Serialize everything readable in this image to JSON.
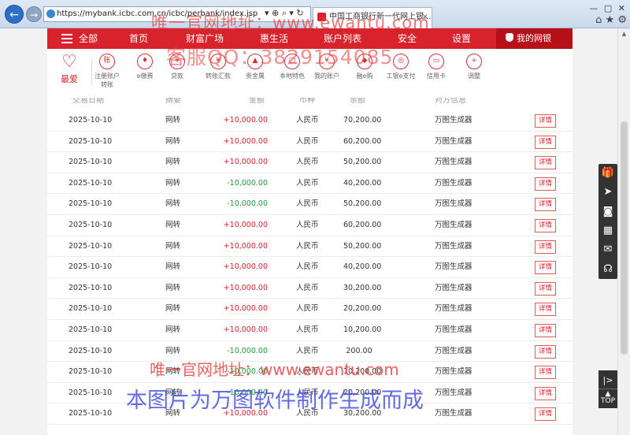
{
  "browser": {
    "url": "https://mybank.icbc.com.cn/icbc/perbank/index.jsp",
    "tab_title": "中国工商银行新一代网上银...",
    "tab_close": "×",
    "window_controls": "— ▢ ✕",
    "home_icons": "⌂ ★ ⚙",
    "addr_tools": "▾ ⊕ ⌕ ▾ ↻"
  },
  "topnav": {
    "menu_label": "全部",
    "items": [
      "首页",
      "财富广场",
      "惠生活",
      "账户列表",
      "安全",
      "设置"
    ],
    "mybank_label": "我的网银"
  },
  "shortcuts": {
    "favorite_label": "最爱",
    "items": [
      {
        "label": "注册账户\n转账",
        "icon": "账"
      },
      {
        "label": "e缴费",
        "icon": "♦"
      },
      {
        "label": "贷款",
        "icon": "¥"
      },
      {
        "label": "转账汇款",
        "icon": "¥"
      },
      {
        "label": "贵金属",
        "icon": "▲"
      },
      {
        "label": "本地特色",
        "icon": "□"
      },
      {
        "label": "我的账户",
        "icon": "¥"
      },
      {
        "label": "融e购",
        "icon": "◆"
      },
      {
        "label": "工银e支付",
        "icon": "◎"
      },
      {
        "label": "信用卡",
        "icon": "▭"
      },
      {
        "label": "调整",
        "icon": "+"
      }
    ]
  },
  "table": {
    "headers": [
      "交易日期",
      "摘要",
      "金额",
      "币种",
      "余额",
      "对方信息"
    ],
    "detail_label": "详情",
    "rows": [
      {
        "date": "2025-10-10",
        "type": "网转",
        "amount": "+10,000.00",
        "sign": "pos",
        "currency": "人民币",
        "balance": "70,200.00",
        "counterparty": "万图生成器"
      },
      {
        "date": "2025-10-10",
        "type": "网转",
        "amount": "+10,000.00",
        "sign": "pos",
        "currency": "人民币",
        "balance": "60,200.00",
        "counterparty": "万图生成器"
      },
      {
        "date": "2025-10-10",
        "type": "网转",
        "amount": "+10,000.00",
        "sign": "pos",
        "currency": "人民币",
        "balance": "50,200.00",
        "counterparty": "万图生成器"
      },
      {
        "date": "2025-10-10",
        "type": "网转",
        "amount": "-10,000.00",
        "sign": "neg",
        "currency": "人民币",
        "balance": "40,200.00",
        "counterparty": "万图生成器"
      },
      {
        "date": "2025-10-10",
        "type": "网转",
        "amount": "-10,000.00",
        "sign": "neg",
        "currency": "人民币",
        "balance": "50,200.00",
        "counterparty": "万图生成器"
      },
      {
        "date": "2025-10-10",
        "type": "网转",
        "amount": "+10,000.00",
        "sign": "pos",
        "currency": "人民币",
        "balance": "60,200.00",
        "counterparty": "万图生成器"
      },
      {
        "date": "2025-10-10",
        "type": "网转",
        "amount": "+10,000.00",
        "sign": "pos",
        "currency": "人民币",
        "balance": "50,200.00",
        "counterparty": "万图生成器"
      },
      {
        "date": "2025-10-10",
        "type": "网转",
        "amount": "+10,000.00",
        "sign": "pos",
        "currency": "人民币",
        "balance": "40,200.00",
        "counterparty": "万图生成器"
      },
      {
        "date": "2025-10-10",
        "type": "网转",
        "amount": "+10,000.00",
        "sign": "pos",
        "currency": "人民币",
        "balance": "30,200.00",
        "counterparty": "万图生成器"
      },
      {
        "date": "2025-10-10",
        "type": "网转",
        "amount": "+10,000.00",
        "sign": "pos",
        "currency": "人民币",
        "balance": "20,200.00",
        "counterparty": "万图生成器"
      },
      {
        "date": "2025-10-10",
        "type": "网转",
        "amount": "+10,000.00",
        "sign": "pos",
        "currency": "人民币",
        "balance": "10,200.00",
        "counterparty": "万图生成器"
      },
      {
        "date": "2025-10-10",
        "type": "网转",
        "amount": "-10,000.00",
        "sign": "neg",
        "currency": "人民币",
        "balance": "200.00",
        "counterparty": "万图生成器"
      },
      {
        "date": "2025-10-10",
        "type": "网转",
        "amount": "-10,000.00",
        "sign": "neg",
        "currency": "人民币",
        "balance": "10,200.00",
        "counterparty": "万图生成器"
      },
      {
        "date": "2025-10-10",
        "type": "网转",
        "amount": "-10,000.00",
        "sign": "neg",
        "currency": "人民币",
        "balance": "20,200.00",
        "counterparty": "万图生成器"
      },
      {
        "date": "2025-10-10",
        "type": "网转",
        "amount": "+10,000.00",
        "sign": "pos",
        "currency": "人民币",
        "balance": "30,200.00",
        "counterparty": "万图生成器"
      }
    ]
  },
  "float_bar": {
    "icons": [
      "gift-icon",
      "send-icon",
      "camera-icon",
      "calendar-icon",
      "mail-icon",
      "headset-icon"
    ],
    "glyphs": [
      "🎁",
      "➤",
      "◙",
      "▦",
      "✉",
      "☊"
    ],
    "expand_label": "|>",
    "top_label": "TOP",
    "top_arrow": "▲"
  },
  "watermarks": {
    "line1": "唯一官网地址：www.ewantu.com",
    "line2": "客服QQ：3829154085",
    "line3": "唯一官网地址：www.ewantu.com",
    "line4": "本图片为万图软件制作生成而成"
  }
}
